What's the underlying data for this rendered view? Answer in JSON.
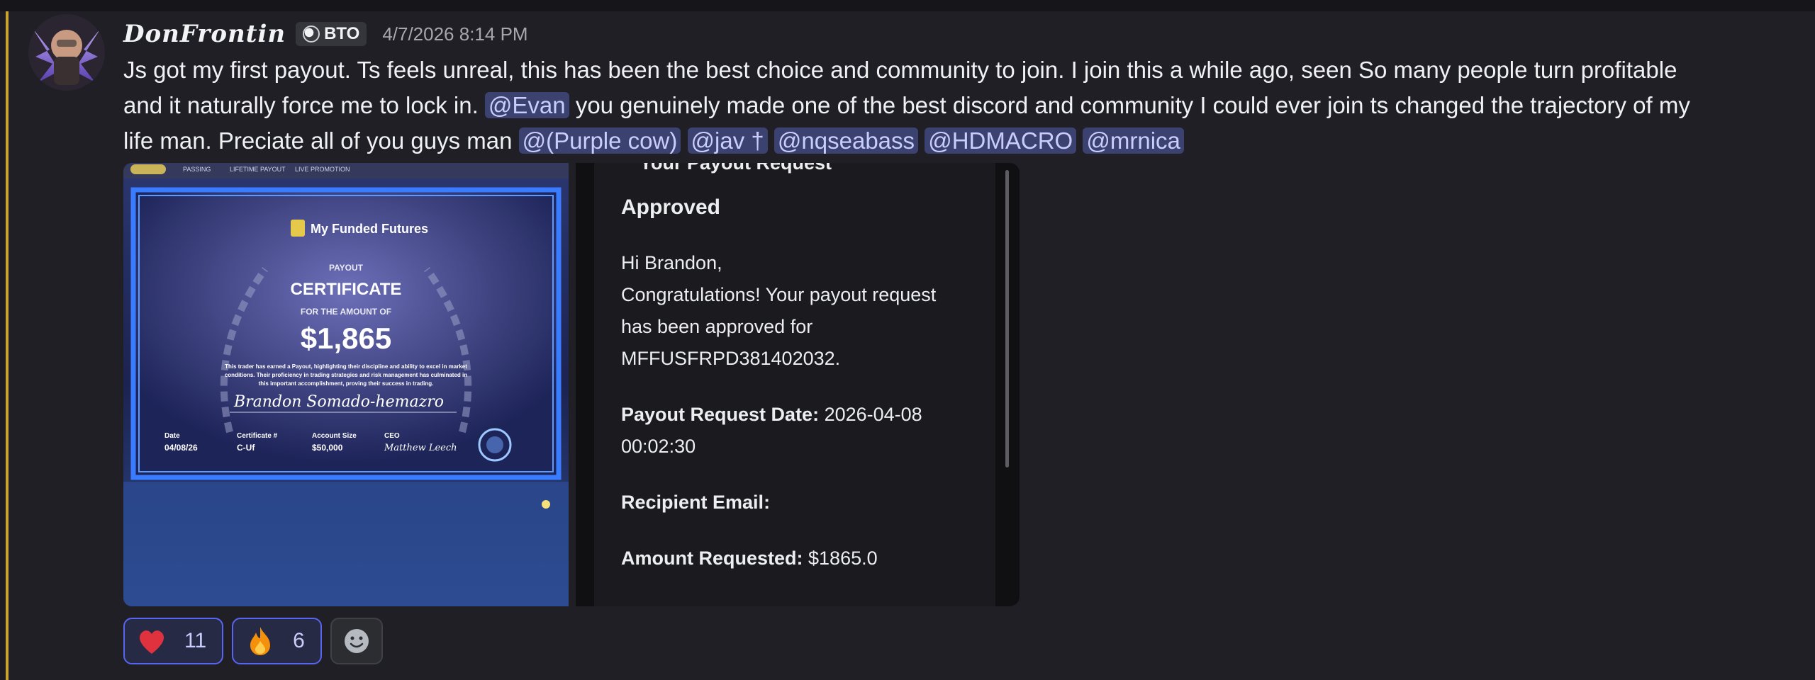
{
  "author": {
    "username": "DonFrontin",
    "clan_tag": "BTO",
    "timestamp": "4/7/2026 8:14 PM",
    "avatar_icon": "avatar-winged-figure"
  },
  "message": {
    "line1": "Js got my first payout. Ts feels unreal, this has been the best choice and community to join. I join this a while ago, seen So many people turn profitable",
    "line2a": "and it naturally force me to lock in.",
    "mention_evan": "@Evan",
    "line2b": "you genuinely made one of the best discord and community I could ever join ts changed the trajectory of my",
    "line3a": "life man. Preciate all of you guys man",
    "mentions": [
      "@(Purple cow)",
      "@jav †",
      "@nqseabass",
      "@HDMACRO",
      "@mrnica"
    ]
  },
  "certificate": {
    "brand": "My Funded Futures",
    "tabs": [
      "",
      "PASSING",
      "LIFETIME PAYOUT",
      "LIVE PROMOTION"
    ],
    "kicker": "PAYOUT",
    "title": "CERTIFICATE",
    "subtitle": "FOR THE AMOUNT OF",
    "amount": "$1,865",
    "body_line1": "This trader has earned a Payout, highlighting their discipline and ability to excel in market",
    "body_line2": "conditions. Their proficiency in trading strategies and risk management has culminated in",
    "body_line3": "this important accomplishment, proving their success in trading.",
    "signature_name": "Brandon Somado-hemazro",
    "date_label": "Date",
    "date_value": "04/08/26",
    "cert_label": "Certificate #",
    "cert_value": "C-Uf",
    "size_label": "Account Size",
    "size_value": "$50,000",
    "ceo_label": "CEO",
    "ceo_signature": "Matthew Leech"
  },
  "email": {
    "cut_header": "Your Payout Request",
    "status": "Approved",
    "greeting": "Hi Brandon,",
    "congrats_1": "Congratulations! Your payout request",
    "congrats_2": "has been approved for",
    "congrats_3": "MFFUSFRPD381402032.",
    "date_label": "Payout Request Date:",
    "date_value_1": "2026-04-08",
    "date_value_2": "00:02:30",
    "recipient_label": "Recipient Email:",
    "amount_label": "Amount Requested:",
    "amount_value": "$1865.0"
  },
  "reactions": [
    {
      "emoji": "heart-icon",
      "count": "11",
      "color": "#e0323e"
    },
    {
      "emoji": "fire-icon",
      "count": "6",
      "color": "#f4900c"
    }
  ],
  "colors": {
    "mention_bg": "#3c4270",
    "mention_text": "#c9cdfb",
    "highlight_bar": "#c8a332",
    "reaction_border": "#5865f2"
  }
}
